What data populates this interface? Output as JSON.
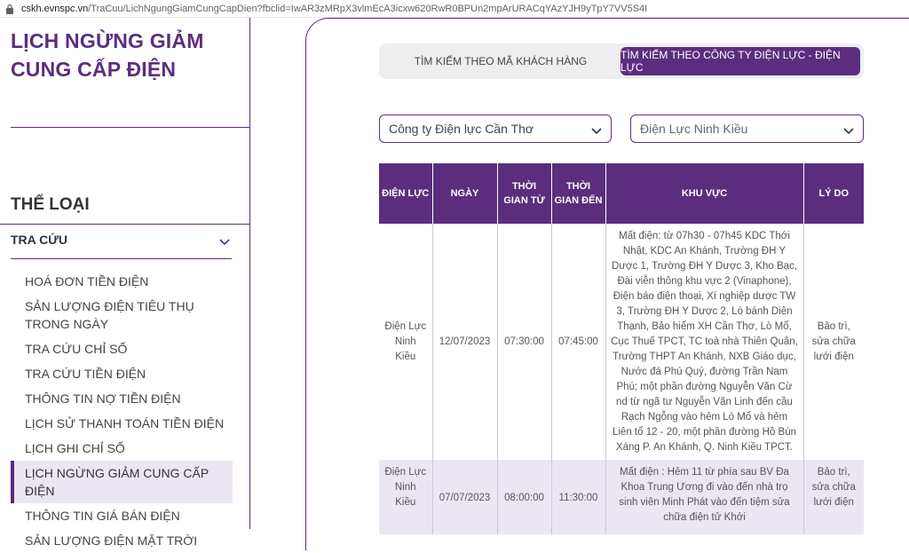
{
  "browser": {
    "url_host": "cskh.evnspc.vn",
    "url_path": "/TraCuu/LichNgungGiamCungCapDien?fbclid=IwAR3zMRpX3vlmEcA3icxw620RwR0BPUn2mpArURACqYAzYJH9yTpY7VV5S4I"
  },
  "sidebar": {
    "title": "LỊCH NGỪNG GIẢM CUNG CẤP ĐIỆN",
    "category_title": "THỂ LOẠI",
    "group_label": "TRA CỨU",
    "items": [
      {
        "label": "HOÁ ĐƠN TIỀN ĐIỆN"
      },
      {
        "label": "SẢN LƯỢNG ĐIỆN TIÊU THỤ TRONG NGÀY"
      },
      {
        "label": "TRA CỨU CHỈ SỐ"
      },
      {
        "label": "TRA CỨU TIỀN ĐIỆN"
      },
      {
        "label": "THÔNG TIN NỢ TIỀN ĐIỆN"
      },
      {
        "label": "LỊCH SỬ THANH TOÁN TIỀN ĐIỆN"
      },
      {
        "label": "LỊCH GHI CHỈ SỐ"
      },
      {
        "label": "LỊCH NGỪNG GIẢM CUNG CẤP ĐIỆN"
      },
      {
        "label": "THÔNG TIN GIÁ BÁN ĐIỆN"
      },
      {
        "label": "SẢN LƯỢNG ĐIỆN MẶT TRỜI"
      }
    ],
    "active_index": 7
  },
  "tabs": [
    {
      "label": "TÌM KIẾM THEO MÃ KHÁCH HÀNG"
    },
    {
      "label": "TÌM KIẾM THEO CÔNG TY ĐIỆN LỰC - ĐIỆN LỰC"
    }
  ],
  "filters": {
    "company": "Công ty Điện lực Cần Thơ",
    "branch": "Điện Lực Ninh Kiều"
  },
  "table": {
    "headers": {
      "dien_luc": "ĐIỆN LỰC",
      "ngay": "NGÀY",
      "tu": "THỜI GIAN TỪ",
      "den": "THỜI GIAN ĐẾN",
      "khu_vuc": "KHU VỰC",
      "ly_do": "LÝ DO"
    },
    "rows": [
      {
        "dien_luc": "Điện Lực Ninh Kiều",
        "ngay": "12/07/2023",
        "tu": "07:30:00",
        "den": "07:45:00",
        "khu_vuc": "Mất điện: từ 07h30 - 07h45 KDC Thới Nhật, KDC An Khánh, Trường ĐH Y Dược 1, Trường ĐH Y Dược 3, Kho Bạc, Đài viễn thông khu vực 2 (Vinaphone), Điện báo điện thoại, Xí nghiệp dược TW 3, Trường ĐH Y Dược 2, Lò bánh Diên Thạnh, Bảo hiểm XH Cần Thơ, Lò Mổ, Cục Thuế TPCT, TC toà nhà Thiên Quân, Trường THPT An Khánh, NXB Giáo dục, Nước đá Phú Quý, đường Trần Nam Phú; một phần đường Nguyễn Văn Cừ nd từ ngã tư Nguyễn Văn Linh đến cầu Rạch Ngỗng vào hẻm Lò Mổ và hẻm Liên tổ 12 - 20, một phần đường Hồ Bún Xáng P. An Khánh, Q. Ninh Kiều TPCT.",
        "ly_do": "Bảo trì, sửa chữa lưới điện"
      },
      {
        "dien_luc": "Điện Lực Ninh Kiều",
        "ngay": "07/07/2023",
        "tu": "08:00:00",
        "den": "11:30:00",
        "khu_vuc": "Mất điện : Hẻm 11 từ phía sau BV Đa Khoa Trung Ương đi vào đến nhà trọ sinh viên Minh Phát vào đến tiệm sửa chữa điện tử Khởi",
        "ly_do": "Bảo trì, sửa chữa lưới điện"
      }
    ]
  },
  "colors": {
    "brand": "#5c2d7e",
    "row_alt": "#ece6f2"
  }
}
